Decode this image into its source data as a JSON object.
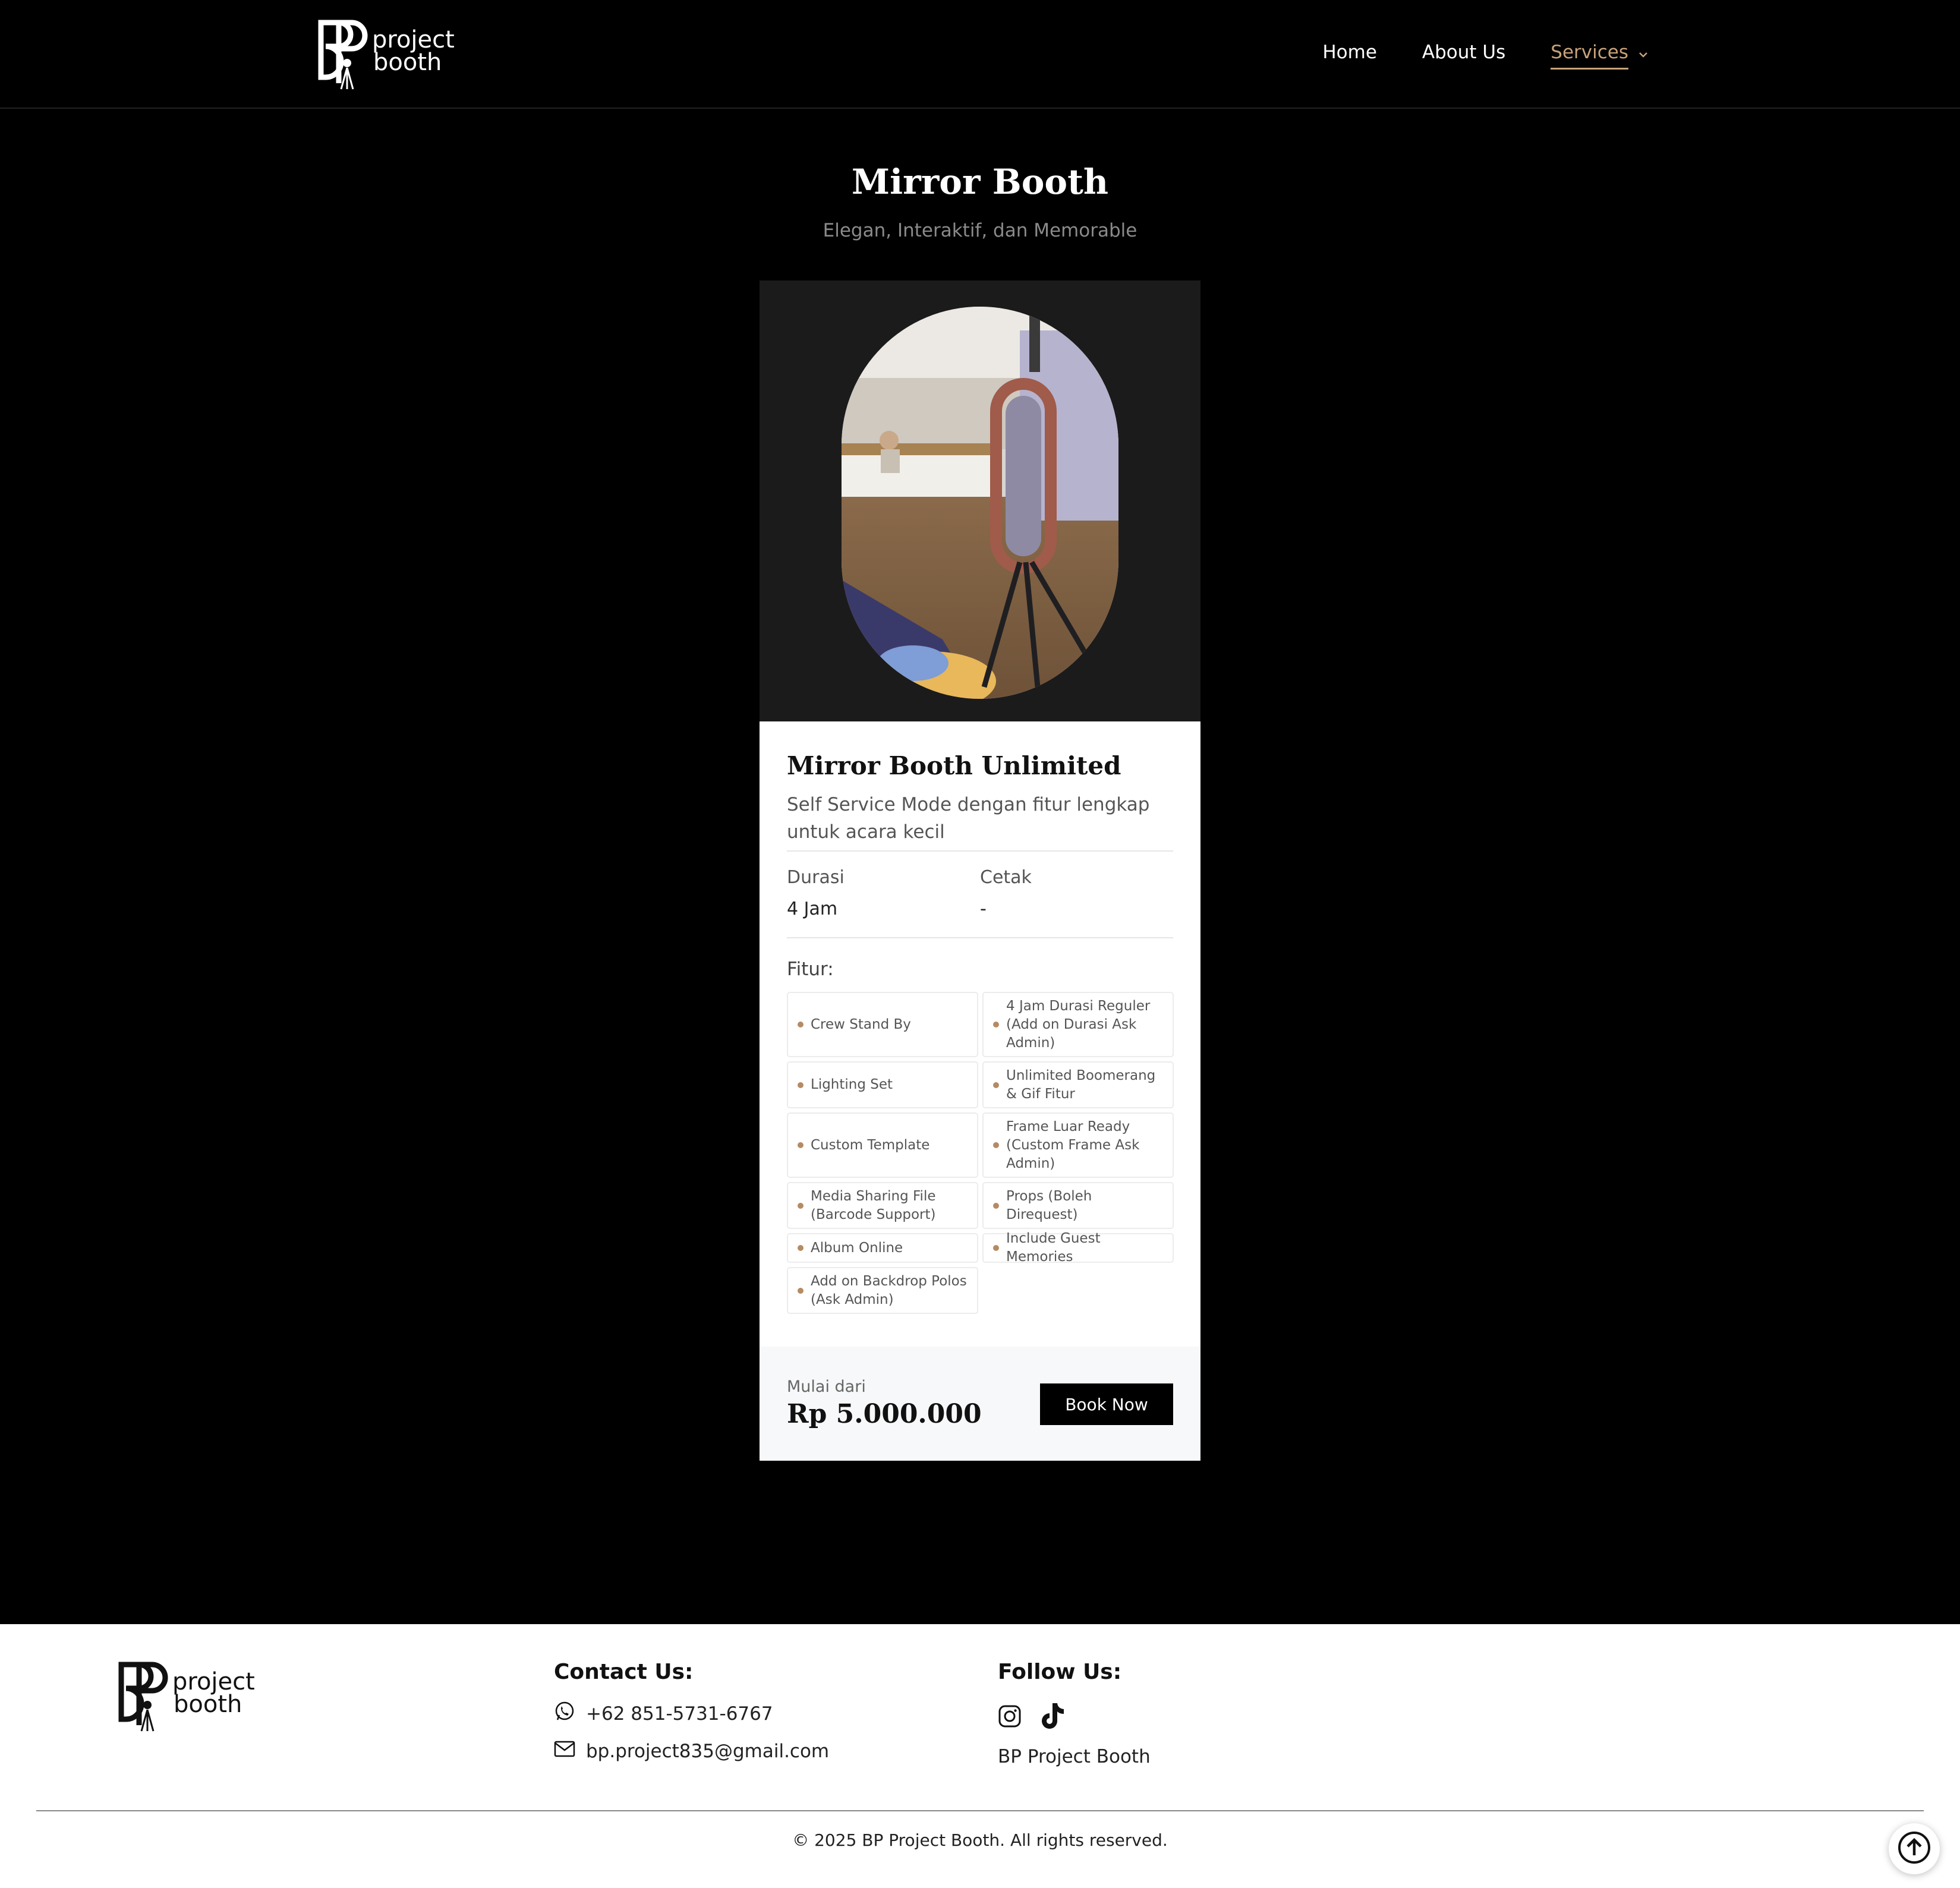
{
  "header": {
    "logo": {
      "text_line1": "project",
      "text_line2": "booth"
    },
    "nav": [
      {
        "label": "Home"
      },
      {
        "label": "About Us"
      },
      {
        "label": "Services",
        "active": true
      }
    ]
  },
  "hero": {
    "title": "Mirror Booth",
    "subtitle": "Elegan, Interaktif, dan Memorable"
  },
  "package": {
    "title": "Mirror Booth Unlimited",
    "description": "Self Service Mode dengan fitur lengkap untuk acara kecil",
    "duration_label": "Durasi",
    "duration_value": "4 Jam",
    "print_label": "Cetak",
    "print_value": "-",
    "features_label": "Fitur:",
    "features": [
      "Crew Stand By",
      "4 Jam Durasi Reguler (Add on Durasi Ask Admin)",
      "Lighting Set",
      "Unlimited Boomerang & Gif Fitur",
      "Custom Template",
      "Frame Luar Ready (Custom Frame Ask Admin)",
      "Media Sharing File (Barcode Support)",
      "Props (Boleh Direquest)",
      "Album Online",
      "Include Guest Memories",
      "Add on Backdrop Polos (Ask Admin)"
    ],
    "price_label": "Mulai dari",
    "price": "Rp 5.000.000",
    "cta": "Book Now"
  },
  "footer": {
    "logo": {
      "text_line1": "project",
      "text_line2": "booth"
    },
    "contact_heading": "Contact Us:",
    "phone": "+62 851-5731-6767",
    "email": "bp.project835@gmail.com",
    "follow_heading": "Follow Us:",
    "social_name": "BP Project Booth",
    "copyright": "© 2025 BP Project Booth. All rights reserved."
  },
  "icons": {
    "whatsapp": "whatsapp-icon",
    "email": "mail-icon",
    "instagram": "instagram-icon",
    "tiktok": "tiktok-icon",
    "back_to_top": "arrow-up-circle-icon",
    "dropdown": "chevron-down-icon"
  },
  "colors": {
    "accent": "#c8a27a",
    "feature_dot": "#b58b63",
    "page_bg": "#000000",
    "media_bg": "#1b1b1b",
    "price_bg": "#f7f8fa"
  }
}
